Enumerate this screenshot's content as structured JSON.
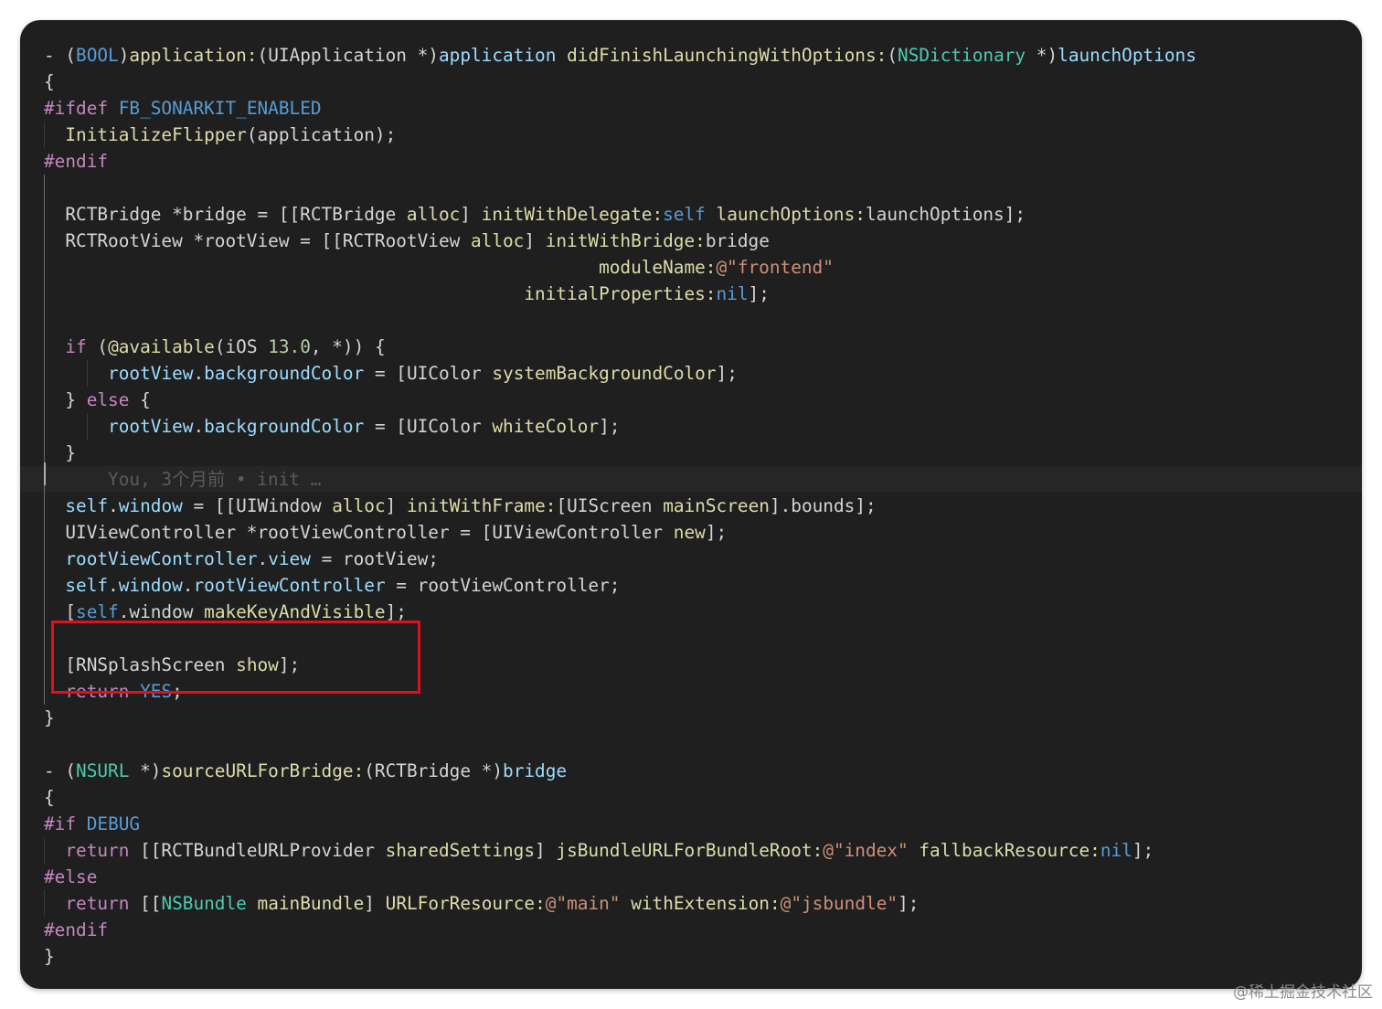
{
  "watermark": "@稀土掘金技术社区",
  "highlight": {
    "color": "#e0101c"
  },
  "colors": {
    "background": "#1f1f1f",
    "keyword": "#c586c0",
    "type": "#4ec9b0",
    "function": "#dcdcaa",
    "variable": "#9cdcfe",
    "constant": "#569cd6",
    "string": "#ce9178",
    "number": "#b5cea8"
  },
  "lines": [
    {
      "tokens": [
        [
          "plain",
          "- ("
        ],
        [
          "blue",
          "BOOL"
        ],
        [
          "plain",
          ")"
        ],
        [
          "fn",
          "application:"
        ],
        [
          "plain",
          "(UIApplication *)"
        ],
        [
          "var",
          "application"
        ],
        [
          "plain",
          " "
        ],
        [
          "fn",
          "didFinishLaunchingWithOptions:"
        ],
        [
          "plain",
          "("
        ],
        [
          "type",
          "NSDictionary"
        ],
        [
          "plain",
          " *)"
        ],
        [
          "var",
          "launchOptions"
        ]
      ]
    },
    {
      "tokens": [
        [
          "plain",
          "{"
        ]
      ]
    },
    {
      "tokens": [
        [
          "kw",
          "#ifdef"
        ],
        [
          "plain",
          " "
        ],
        [
          "macro",
          "FB_SONARKIT_ENABLED"
        ]
      ]
    },
    {
      "tokens": [
        [
          "plain",
          "  "
        ],
        [
          "fn",
          "InitializeFlipper"
        ],
        [
          "plain",
          "(application);"
        ]
      ]
    },
    {
      "tokens": [
        [
          "kw",
          "#endif"
        ]
      ]
    },
    {
      "tokens": []
    },
    {
      "tokens": [
        [
          "plain",
          "  RCTBridge *bridge = [[RCTBridge "
        ],
        [
          "fn",
          "alloc"
        ],
        [
          "plain",
          "] "
        ],
        [
          "fn",
          "initWithDelegate:"
        ],
        [
          "blue",
          "self"
        ],
        [
          "plain",
          " "
        ],
        [
          "fn",
          "launchOptions:"
        ],
        [
          "plain",
          "launchOptions];"
        ]
      ]
    },
    {
      "tokens": [
        [
          "plain",
          "  RCTRootView *rootView = [[RCTRootView "
        ],
        [
          "fn",
          "alloc"
        ],
        [
          "plain",
          "] "
        ],
        [
          "fn",
          "initWithBridge:"
        ],
        [
          "plain",
          "bridge"
        ]
      ]
    },
    {
      "tokens": [
        [
          "plain",
          "                                                    "
        ],
        [
          "fn",
          "moduleName:"
        ],
        [
          "str",
          "@\"frontend\""
        ]
      ]
    },
    {
      "tokens": [
        [
          "plain",
          "                                             "
        ],
        [
          "fn",
          "initialProperties:"
        ],
        [
          "blue",
          "nil"
        ],
        [
          "plain",
          "];"
        ]
      ]
    },
    {
      "tokens": []
    },
    {
      "tokens": [
        [
          "plain",
          "  "
        ],
        [
          "kw",
          "if"
        ],
        [
          "plain",
          " ("
        ],
        [
          "fn",
          "@available"
        ],
        [
          "plain",
          "(iOS "
        ],
        [
          "num",
          "13.0"
        ],
        [
          "plain",
          ", *)) {"
        ]
      ]
    },
    {
      "tokens": [
        [
          "plain",
          "      "
        ],
        [
          "var",
          "rootView"
        ],
        [
          "plain",
          "."
        ],
        [
          "var",
          "backgroundColor"
        ],
        [
          "plain",
          " = [UIColor "
        ],
        [
          "fn",
          "systemBackgroundColor"
        ],
        [
          "plain",
          "];"
        ]
      ]
    },
    {
      "tokens": [
        [
          "plain",
          "  } "
        ],
        [
          "kw",
          "else"
        ],
        [
          "plain",
          " {"
        ]
      ]
    },
    {
      "tokens": [
        [
          "plain",
          "      "
        ],
        [
          "var",
          "rootView"
        ],
        [
          "plain",
          "."
        ],
        [
          "var",
          "backgroundColor"
        ],
        [
          "plain",
          " = [UIColor "
        ],
        [
          "fn",
          "whiteColor"
        ],
        [
          "plain",
          "];"
        ]
      ]
    },
    {
      "tokens": [
        [
          "plain",
          "  }"
        ]
      ]
    },
    {
      "tokens": [
        [
          "plain",
          "      "
        ],
        [
          "blame",
          "You, 3个月前 • init …"
        ]
      ],
      "highlight": true
    },
    {
      "tokens": [
        [
          "plain",
          "  "
        ],
        [
          "var",
          "self"
        ],
        [
          "plain",
          "."
        ],
        [
          "var",
          "window"
        ],
        [
          "plain",
          " = [[UIWindow "
        ],
        [
          "fn",
          "alloc"
        ],
        [
          "plain",
          "] "
        ],
        [
          "fn",
          "initWithFrame:"
        ],
        [
          "plain",
          "[UIScreen "
        ],
        [
          "fn",
          "mainScreen"
        ],
        [
          "plain",
          "].bounds];"
        ]
      ]
    },
    {
      "tokens": [
        [
          "plain",
          "  UIViewController *rootViewController = [UIViewController "
        ],
        [
          "fn",
          "new"
        ],
        [
          "plain",
          "];"
        ]
      ]
    },
    {
      "tokens": [
        [
          "plain",
          "  "
        ],
        [
          "var",
          "rootViewController"
        ],
        [
          "plain",
          "."
        ],
        [
          "var",
          "view"
        ],
        [
          "plain",
          " = rootView;"
        ]
      ]
    },
    {
      "tokens": [
        [
          "plain",
          "  "
        ],
        [
          "var",
          "self"
        ],
        [
          "plain",
          "."
        ],
        [
          "var",
          "window"
        ],
        [
          "plain",
          "."
        ],
        [
          "var",
          "rootViewController"
        ],
        [
          "plain",
          " = rootViewController;"
        ]
      ]
    },
    {
      "tokens": [
        [
          "plain",
          "  ["
        ],
        [
          "blue",
          "self"
        ],
        [
          "plain",
          ".window "
        ],
        [
          "fn",
          "makeKeyAndVisible"
        ],
        [
          "plain",
          "];"
        ]
      ]
    },
    {
      "tokens": []
    },
    {
      "tokens": [
        [
          "plain",
          "  [RNSplashScreen "
        ],
        [
          "fn",
          "show"
        ],
        [
          "plain",
          "];"
        ]
      ]
    },
    {
      "tokens": [
        [
          "plain",
          "  "
        ],
        [
          "kw",
          "return"
        ],
        [
          "plain",
          " "
        ],
        [
          "blue",
          "YES"
        ],
        [
          "plain",
          ";"
        ]
      ]
    },
    {
      "tokens": [
        [
          "plain",
          "}"
        ]
      ]
    },
    {
      "tokens": []
    },
    {
      "tokens": [
        [
          "plain",
          "- ("
        ],
        [
          "type",
          "NSURL"
        ],
        [
          "plain",
          " *)"
        ],
        [
          "fn",
          "sourceURLForBridge:"
        ],
        [
          "plain",
          "(RCTBridge *)"
        ],
        [
          "var",
          "bridge"
        ]
      ]
    },
    {
      "tokens": [
        [
          "plain",
          "{"
        ]
      ]
    },
    {
      "tokens": [
        [
          "kw",
          "#if"
        ],
        [
          "plain",
          " "
        ],
        [
          "macro",
          "DEBUG"
        ]
      ]
    },
    {
      "tokens": [
        [
          "plain",
          "  "
        ],
        [
          "kw",
          "return"
        ],
        [
          "plain",
          " [[RCTBundleURLProvider "
        ],
        [
          "fn",
          "sharedSettings"
        ],
        [
          "plain",
          "] "
        ],
        [
          "fn",
          "jsBundleURLForBundleRoot:"
        ],
        [
          "str",
          "@\"index\""
        ],
        [
          "plain",
          " "
        ],
        [
          "fn",
          "fallbackResource:"
        ],
        [
          "blue",
          "nil"
        ],
        [
          "plain",
          "];"
        ]
      ]
    },
    {
      "tokens": [
        [
          "kw",
          "#else"
        ]
      ]
    },
    {
      "tokens": [
        [
          "plain",
          "  "
        ],
        [
          "kw",
          "return"
        ],
        [
          "plain",
          " [["
        ],
        [
          "type",
          "NSBundle"
        ],
        [
          "plain",
          " "
        ],
        [
          "fn",
          "mainBundle"
        ],
        [
          "plain",
          "] "
        ],
        [
          "fn",
          "URLForResource:"
        ],
        [
          "str",
          "@\"main\""
        ],
        [
          "plain",
          " "
        ],
        [
          "fn",
          "withExtension:"
        ],
        [
          "str",
          "@\"jsbundle\""
        ],
        [
          "plain",
          "];"
        ]
      ]
    },
    {
      "tokens": [
        [
          "kw",
          "#endif"
        ]
      ]
    },
    {
      "tokens": [
        [
          "plain",
          "}"
        ]
      ]
    }
  ]
}
